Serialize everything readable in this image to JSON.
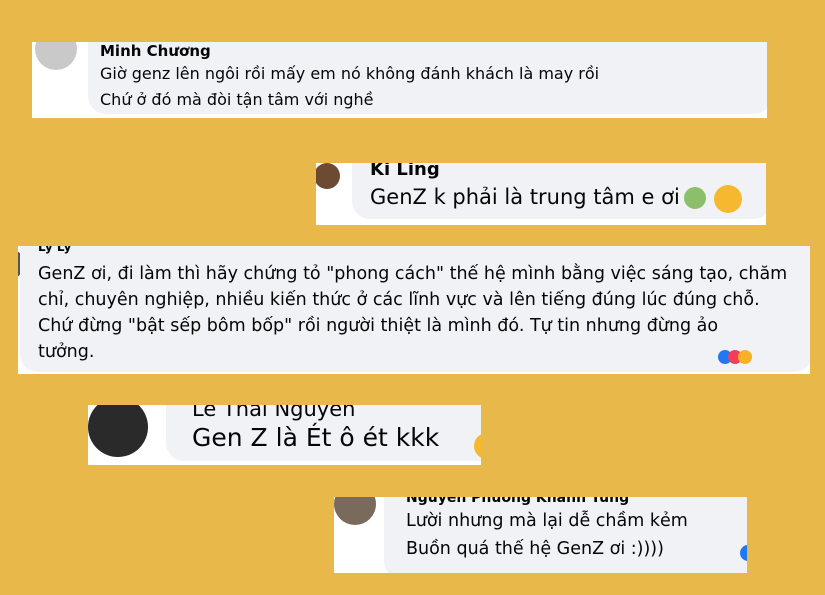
{
  "comments": [
    {
      "name": "Minh Chương",
      "lines": [
        "Giờ genz lên ngôi rồi mấy em nó không đánh khách là may rồi",
        "Chứ ở đó mà đòi tận tâm với nghề"
      ]
    },
    {
      "name": "Ki Ling",
      "lines": [
        "GenZ k phải là trung tâm e ơi"
      ]
    },
    {
      "name": "Ly Ly",
      "lines": [
        "GenZ ơi, đi làm thì hãy chứng tỏ \"phong cách\" thế hệ mình bằng việc sáng tạo, chăm",
        "chỉ, chuyên nghiệp, nhiều kiến thức ở các lĩnh vực và lên tiếng đúng lúc đúng chỗ.",
        "Chứ đừng \"bật sếp bôm bốp\" rồi người thiệt là mình đó. Tự tin nhưng đừng ảo",
        "tưởng."
      ]
    },
    {
      "name": "Lê Thái Nguyên",
      "lines": [
        "Gen Z là Ét ô ét kkk"
      ]
    },
    {
      "name": "Nguyễn Phương Khánh Tùng",
      "lines": [
        "Lười nhưng mà lại dễ chầm kẻm",
        "Buồn quá thế hệ GenZ ơi :))))"
      ]
    }
  ],
  "colors": {
    "background": "#e8b84a",
    "bubble": "#f0f2f5",
    "text": "#050505"
  }
}
